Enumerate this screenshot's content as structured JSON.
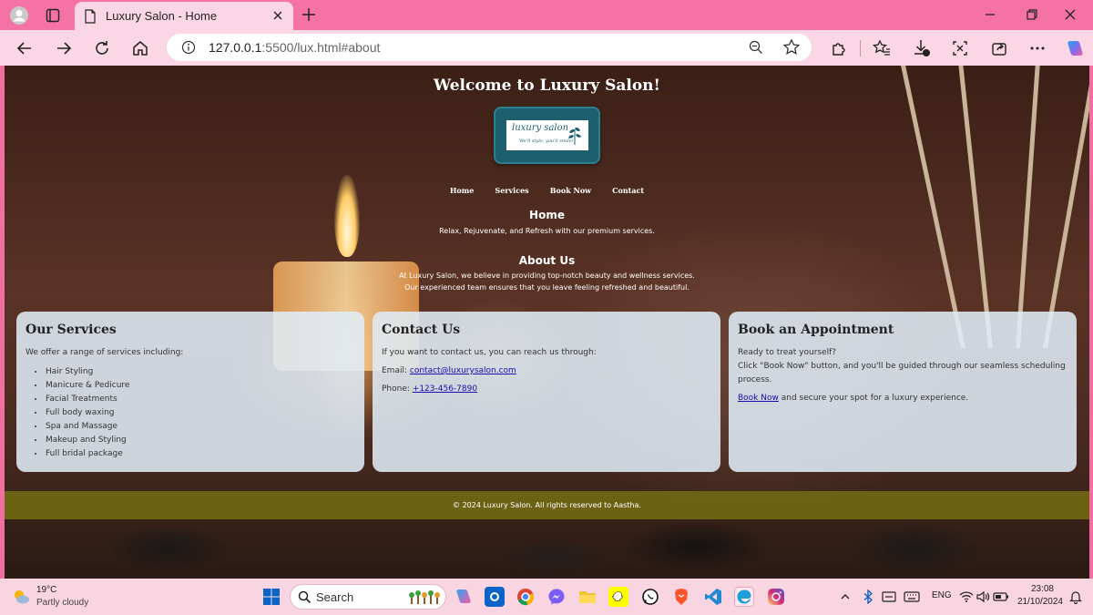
{
  "browser": {
    "tab_title": "Luxury Salon - Home",
    "url_host": "127.0.0.1",
    "url_rest": ":5500/lux.html#about",
    "icons": [
      "profile-icon",
      "tab-actions-icon",
      "page-icon",
      "close-icon",
      "new-tab-icon",
      "minimize-icon",
      "restore-icon",
      "window-close-icon",
      "back-icon",
      "forward-icon",
      "refresh-icon",
      "home-icon",
      "info-icon",
      "zoom-icon",
      "favorite-star-icon",
      "extensions-icon",
      "favorites-icon",
      "downloads-icon",
      "screenshot-icon",
      "share-icon",
      "more-icon",
      "copilot-icon"
    ]
  },
  "site": {
    "title": "Welcome to Luxury Salon!",
    "logo_text": "luxury salon",
    "logo_tagline": "We'll style, you'll smile!",
    "nav": [
      "Home",
      "Services",
      "Book Now",
      "Contact"
    ],
    "home": {
      "heading": "Home",
      "text": "Relax, Rejuvenate, and Refresh with our premium services."
    },
    "about": {
      "heading": "About Us",
      "line1": "At Luxury Salon, we believe in providing top-notch beauty and wellness services.",
      "line2": "Our experienced team ensures that you leave feeling refreshed and beautiful."
    },
    "services": {
      "heading": "Our Services",
      "intro": "We offer a range of services including:",
      "items": [
        "Hair Styling",
        "Manicure & Pedicure",
        "Facial Treatments",
        "Full body waxing",
        "Spa and Massage",
        "Makeup and Styling",
        "Full bridal package"
      ]
    },
    "contact": {
      "heading": "Contact Us",
      "intro": "If you want to contact us, you can reach us through:",
      "email_label": "Email: ",
      "email": "contact@luxurysalon.com",
      "phone_label": "Phone: ",
      "phone": "+123-456-7890"
    },
    "booking": {
      "heading": "Book an Appointment",
      "line1": "Ready to treat yourself?",
      "line2": "Click \"Book Now\" button, and you'll be guided through our seamless scheduling process.",
      "link": "Book Now",
      "after_link": " and secure your spot for a luxury experience."
    },
    "footer": "© 2024 Luxury Salon. All rights reserved to Aastha."
  },
  "taskbar": {
    "temp": "19°C",
    "weather": "Partly cloudy",
    "search_label": "Search",
    "lang": "ENG",
    "time": "23:08",
    "date": "21/10/2024"
  },
  "colors": {
    "tabstrip": "#f472a4",
    "toolbar": "#fbd7e6",
    "card_bg": "#e0ecf6",
    "footer_bg": "#706814",
    "logo_bg": "#1e5f6e"
  }
}
